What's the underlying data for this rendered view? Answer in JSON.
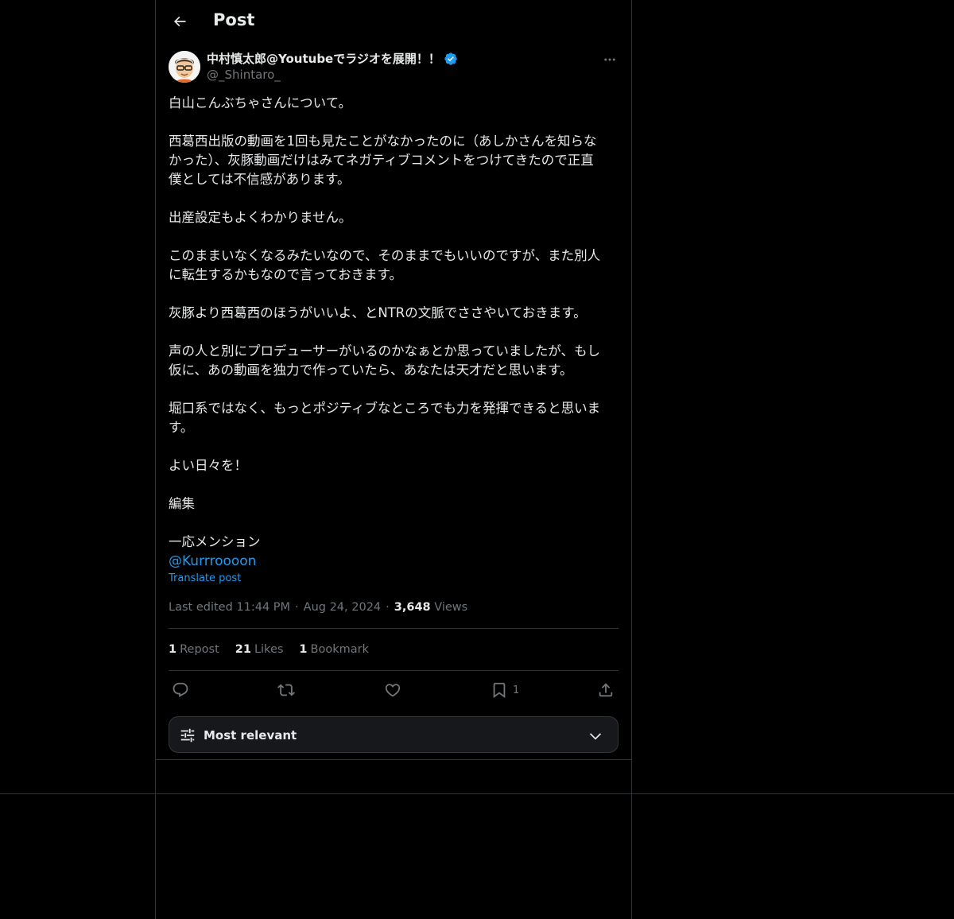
{
  "header": {
    "title": "Post",
    "back_icon": "arrow-left-icon"
  },
  "author": {
    "display_name": "中村慎太郎@Youtubeでラジオを展開！！",
    "handle": "@_Shintaro_",
    "verified": true,
    "verified_color": "#1d9bf0"
  },
  "post": {
    "paragraphs": [
      [
        "白山こんぶちゃさんについて。"
      ],
      [
        "西葛西出版の動画を1回も見たことがなかったのに（あしかさんを知らな",
        "かった）、灰豚動画だけはみてネガティブコメントをつけてきたので正直",
        "僕としては不信感があります。"
      ],
      [
        "出産設定もよくわかりません。"
      ],
      [
        "このままいなくなるみたいなので、そのままでもいいのですが、また別人",
        "に転生するかもなので言っておきます。"
      ],
      [
        "灰豚より西葛西のほうがいいよ、とNTRの文脈でささやいておきます。"
      ],
      [
        "声の人と別にプロデューサーがいるのかなぁとか思っていましたが、もし",
        "仮に、あの動画を独力で作っていたら、あなたは天才だと思います。"
      ],
      [
        "堀口系ではなく、もっとポジティブなところでも力を発揮できると思いま",
        "す。"
      ],
      [
        "よい日々を！"
      ],
      [
        "編集"
      ],
      [
        "一応メンション"
      ]
    ],
    "mention": "@Kurrroooon",
    "translate": "Translate post"
  },
  "meta": {
    "edited": "Last edited 11:44 PM",
    "date": "Aug 24, 2024",
    "views_count": "3,648",
    "views_label": "Views",
    "separator": "·"
  },
  "stats": {
    "reposts_count": "1",
    "reposts_label": "Repost",
    "likes_count": "21",
    "likes_label": "Likes",
    "bookmarks_count": "1",
    "bookmarks_label": "Bookmark"
  },
  "actions": {
    "reply_icon": "reply-icon",
    "repost_icon": "repost-icon",
    "like_icon": "heart-icon",
    "bookmark_icon": "bookmark-icon",
    "bookmark_count": "1",
    "share_icon": "share-icon"
  },
  "sort": {
    "label": "Most relevant",
    "icon": "sliders-icon",
    "chevron": "chevron-down-icon"
  },
  "colors": {
    "background": "#000000",
    "text": "#e7e9ea",
    "muted": "#71767b",
    "accent": "#1d9bf0",
    "border": "#2f3336"
  }
}
